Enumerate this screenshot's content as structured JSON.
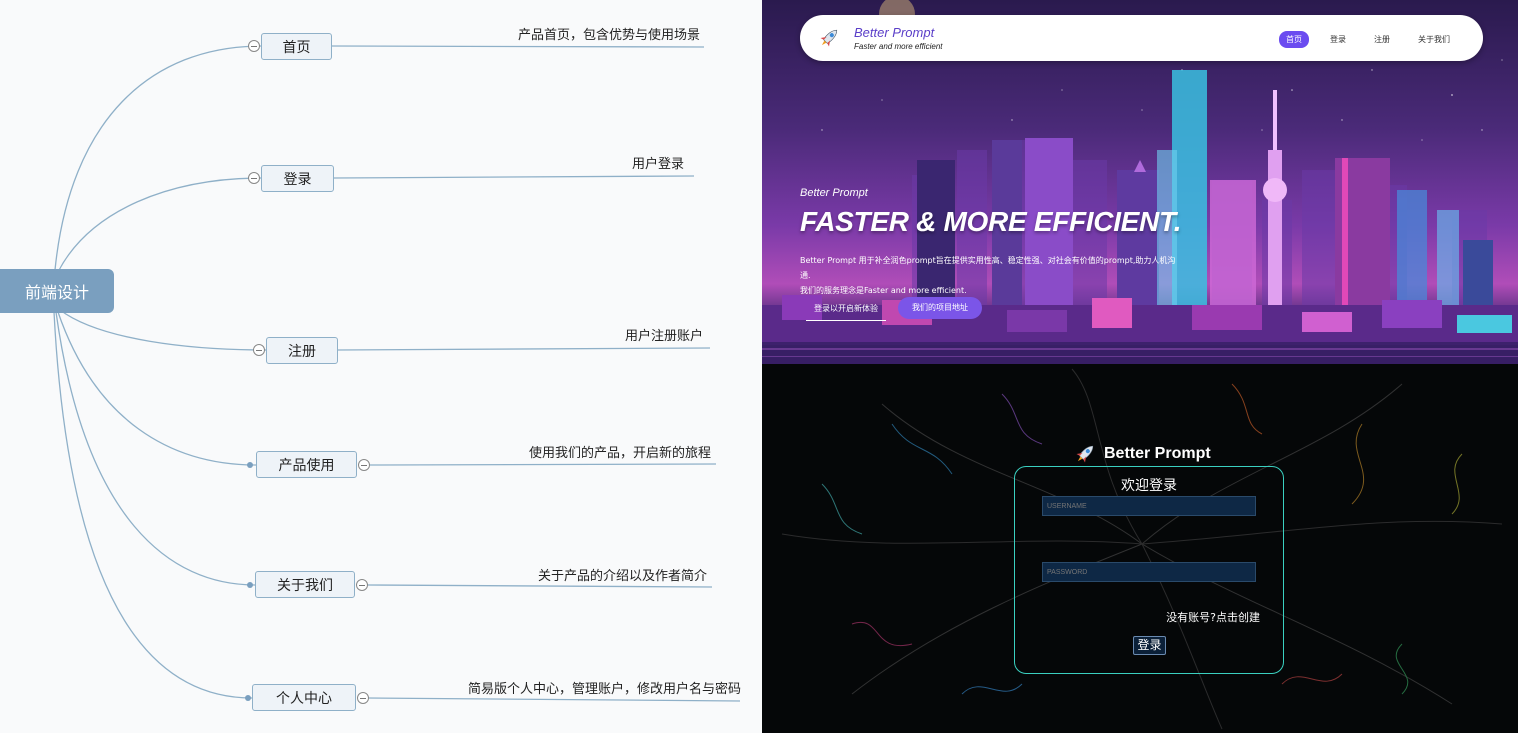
{
  "mindmap": {
    "root": "前端设计",
    "branches": [
      {
        "label": "首页",
        "desc": "产品首页，包含优势与使用场景"
      },
      {
        "label": "登录",
        "desc": "用户登录"
      },
      {
        "label": "注册",
        "desc": "用户注册账户"
      },
      {
        "label": "产品使用",
        "desc": "使用我们的产品，开启新的旅程"
      },
      {
        "label": "关于我们",
        "desc": "关于产品的介绍以及作者简介"
      },
      {
        "label": "个人中心",
        "desc": "简易版个人中心，管理账户，修改用户名与密码"
      }
    ]
  },
  "home": {
    "brand": "Better Prompt",
    "tagline": "Faster and more efficient",
    "nav": [
      "首页",
      "登录",
      "注册",
      "关于我们"
    ],
    "hero_sub": "Better Prompt",
    "hero_title": "FASTER & MORE EFFICIENT.",
    "hero_desc_1": "Better Prompt 用于补全润色prompt旨在提供实用性高、稳定性强、对社会有价值的prompt,助力人机沟通.",
    "hero_desc_2": "我们的服务理念是Faster and more efficient.",
    "btn_primary": "登录以开启新体验",
    "btn_secondary": "我们的项目地址",
    "accent": "#6b4cf0"
  },
  "login": {
    "brand": "Better Prompt",
    "title": "欢迎登录",
    "username_placeholder": "USERNAME",
    "password_placeholder": "PASSWORD",
    "register_link": "没有账号?点击创建",
    "submit": "登录",
    "border_color": "#3ad0c0"
  }
}
